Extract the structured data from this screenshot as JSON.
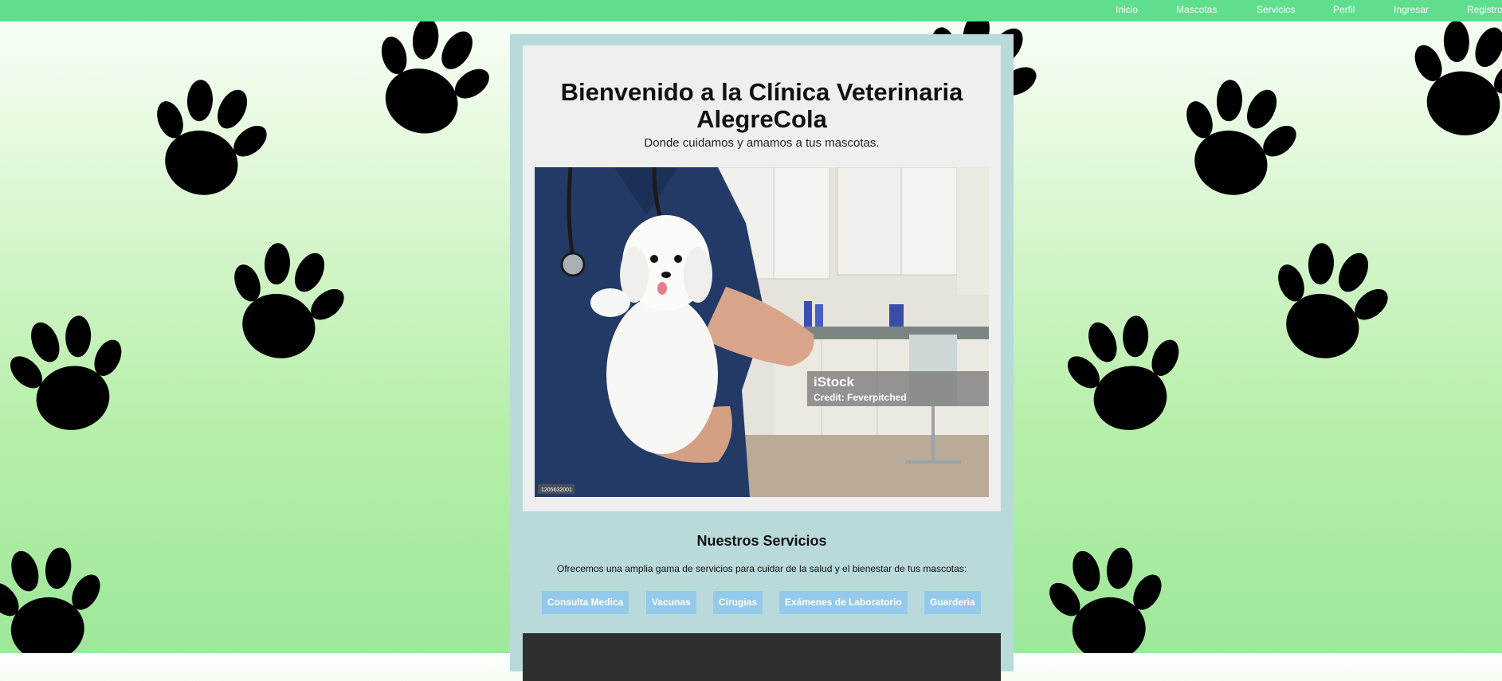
{
  "nav": {
    "items": [
      "Inicio",
      "Mascotas",
      "Servicios",
      "Perfil",
      "Ingresar",
      "Registro"
    ]
  },
  "welcome": {
    "title": "Bienvenido a la Clínica Veterinaria AlegreCola",
    "subtitle": "Donde cuidamos y amamos a tus mascotas.",
    "image_watermark": "iStock",
    "image_credit": "Credit: Feverpitched",
    "image_id": "1205632001"
  },
  "services": {
    "title": "Nuestros Servicios",
    "description": "Ofrecemos una amplia gama de servicios para cuidar de la salud y el bienestar de tus mascotas:",
    "buttons": [
      "Consulta Medica",
      "Vacunas",
      "Cirugias",
      "Exámenes de Laboratorio",
      "Guarderia"
    ]
  },
  "colors": {
    "navbar": "#5fdf8e",
    "panel": "#b9dadb",
    "card": "#efefef",
    "service_button": "#95c9ea",
    "footer": "#2f2f2f"
  },
  "icons": [
    "paw-print-icon",
    "stethoscope-icon"
  ]
}
